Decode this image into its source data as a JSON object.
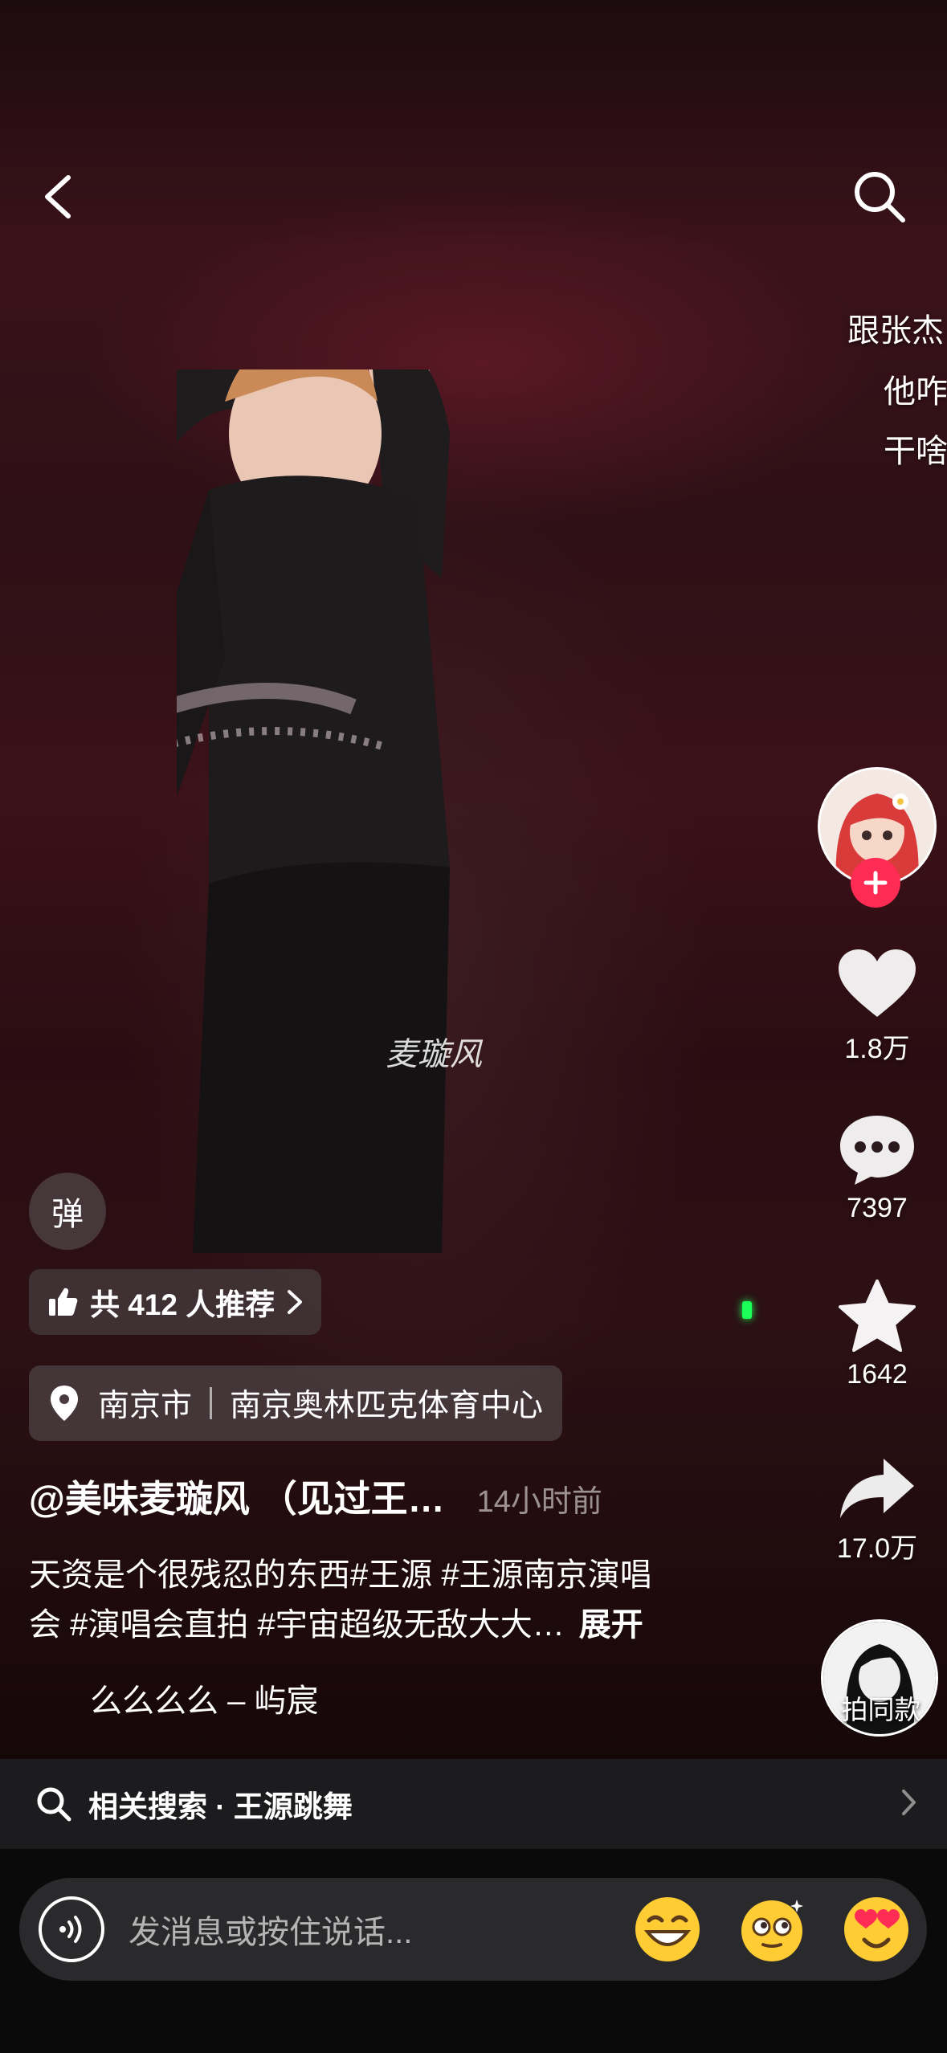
{
  "header": {
    "back_icon": "chevron-left-icon",
    "search_icon": "search-icon"
  },
  "danmaku": [
    "跟张杰",
    "他咋",
    "干啥"
  ],
  "sidebar": {
    "avatar_icon": "cartoon-girl-avatar",
    "like_count": "1.8万",
    "comment_count": "7397",
    "favorite_count": "1642",
    "share_count": "17.0万",
    "sound_label": "拍同款"
  },
  "danmu_toggle_label": "弹",
  "recommend": {
    "label": "共 412 人推荐"
  },
  "location": {
    "city": "南京市",
    "venue": "南京奥林匹克体育中心"
  },
  "post": {
    "author": "@美味麦璇风 （见过王…",
    "time": "14小时前",
    "description_line1": "天资是个很残忍的东西#王源 #王源南京演唱",
    "description_line2": "会 #演唱会直拍 #宇宙超级无敌大大…",
    "expand_label": "展开",
    "music": "么么么么 – 屿宸"
  },
  "watermark": "麦璇风",
  "related_search": {
    "label": "相关搜索 · 王源跳舞"
  },
  "input": {
    "placeholder": "发消息或按住说话..."
  },
  "colors": {
    "accent": "#fe2c55",
    "input_bg": "#2a2a2c",
    "related_bg": "#1c1c1e"
  }
}
